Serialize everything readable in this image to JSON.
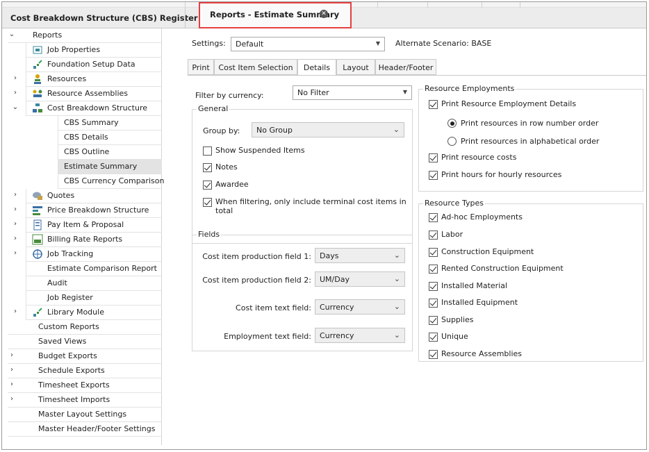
{
  "header": {
    "left_title": "Cost Breakdown Structure (CBS) Register",
    "active_tab": "Reports - Estimate Summary"
  },
  "sidebar": {
    "root": "Reports",
    "items": [
      {
        "label": "Job Properties"
      },
      {
        "label": "Foundation Setup Data"
      },
      {
        "label": "Resources"
      },
      {
        "label": "Resource Assemblies"
      },
      {
        "label": "Cost Breakdown Structure"
      },
      {
        "label": "CBS Summary"
      },
      {
        "label": "CBS Details"
      },
      {
        "label": "CBS Outline"
      },
      {
        "label": "Estimate Summary"
      },
      {
        "label": "CBS Currency Comparison"
      },
      {
        "label": "Quotes"
      },
      {
        "label": "Price Breakdown Structure"
      },
      {
        "label": "Pay Item & Proposal"
      },
      {
        "label": "Billing Rate Reports"
      },
      {
        "label": "Job Tracking"
      },
      {
        "label": "Estimate Comparison Report"
      },
      {
        "label": "Audit"
      },
      {
        "label": "Job Register"
      },
      {
        "label": "Library Module"
      }
    ],
    "top_items": [
      {
        "label": "Custom Reports"
      },
      {
        "label": "Saved Views"
      },
      {
        "label": "Budget Exports"
      },
      {
        "label": "Schedule Exports"
      },
      {
        "label": "Timesheet Exports"
      },
      {
        "label": "Timesheet Imports"
      },
      {
        "label": "Master Layout Settings"
      },
      {
        "label": "Master Header/Footer Settings"
      }
    ]
  },
  "settings": {
    "label": "Settings:",
    "value": "Default",
    "alternate_label": "Alternate Scenario:",
    "alternate_value": "BASE"
  },
  "tabs": [
    "Print",
    "Cost Item Selection",
    "Details",
    "Layout",
    "Header/Footer"
  ],
  "details": {
    "filter_label": "Filter by currency:",
    "filter_value": "No Filter",
    "general": {
      "title": "General",
      "group_by_label": "Group by:",
      "group_by_value": "No Group",
      "show_suspended": "Show Suspended Items",
      "notes": "Notes",
      "awardee": "Awardee",
      "terminal_line1": "When filtering, only include terminal cost items in",
      "terminal_line2": "total"
    },
    "fields": {
      "title": "Fields",
      "f1_label": "Cost item production field 1:",
      "f1_value": "Days",
      "f2_label": "Cost item production field 2:",
      "f2_value": "UM/Day",
      "f3_label": "Cost item text field:",
      "f3_value": "Currency",
      "f4_label": "Employment text field:",
      "f4_value": "Currency"
    },
    "employments": {
      "title": "Resource Employments",
      "print_details": "Print Resource Employment Details",
      "row_order": "Print resources in row number order",
      "alpha_order": "Print resources in alphabetical order",
      "costs": "Print resource costs",
      "hours": "Print hours for hourly resources"
    },
    "types": {
      "title": "Resource Types",
      "items": [
        "Ad-hoc Employments",
        "Labor",
        "Construction Equipment",
        "Rented Construction Equipment",
        "Installed Material",
        "Installed Equipment",
        "Supplies",
        "Unique",
        "Resource Assemblies"
      ]
    }
  }
}
